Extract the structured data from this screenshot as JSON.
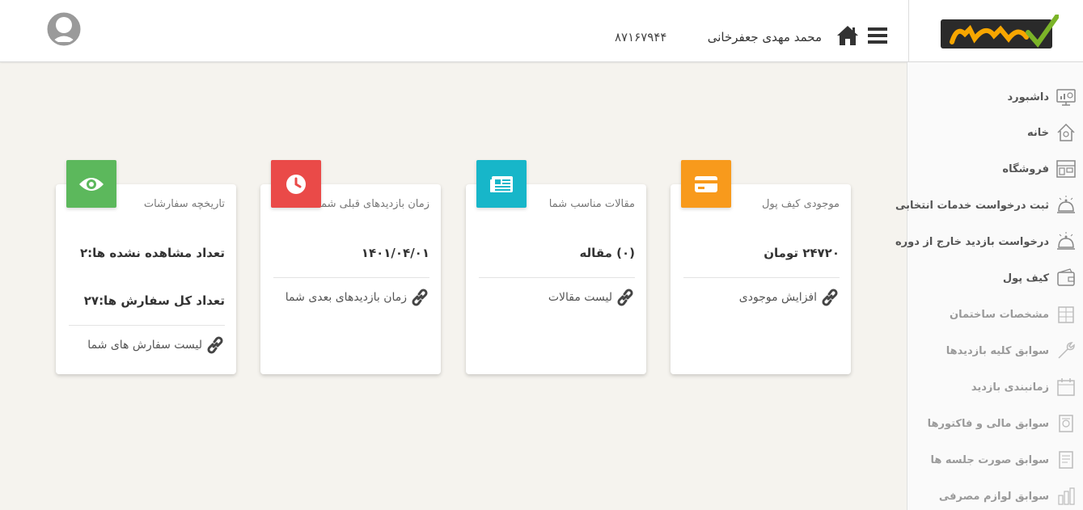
{
  "header": {
    "phone": "۸۷۱۶۷۹۴۴",
    "username": "محمد مهدی جعفرخانی",
    "home_icon": "home-icon",
    "menu_icon": "hamburger-menu-icon",
    "avatar_icon": "user-avatar-icon"
  },
  "logo": {
    "text": "ایمن تزیک",
    "colors": {
      "primary": "#f7a600",
      "dark": "#2a2a2a",
      "check": "#7bb428"
    }
  },
  "sidebar": {
    "items": [
      {
        "label": "داشبورد",
        "icon": "dashboard-icon",
        "state": "active"
      },
      {
        "label": "خانه",
        "icon": "house-icon",
        "state": "active"
      },
      {
        "label": "فروشگاه",
        "icon": "store-icon",
        "state": "active"
      },
      {
        "label": "ثبت درخواست خدمات انتخابی",
        "icon": "service-bell-icon",
        "state": "active"
      },
      {
        "label": "درخواست بازدید خارج از دوره",
        "icon": "service-bell-icon",
        "state": "active"
      },
      {
        "label": "کیف پول",
        "icon": "wallet-icon",
        "state": "active"
      },
      {
        "label": "مشخصات ساختمان",
        "icon": "building-icon",
        "state": "dim"
      },
      {
        "label": "سوابق کلیه بازدیدها",
        "icon": "wrench-icon",
        "state": "dim"
      },
      {
        "label": "زمانبندی بازدید",
        "icon": "calendar-icon",
        "state": "dim"
      },
      {
        "label": "سوابق مالی و فاکتورها",
        "icon": "invoice-icon",
        "state": "dim"
      },
      {
        "label": "سوابق صورت جلسه ها",
        "icon": "minutes-icon",
        "state": "dim"
      },
      {
        "label": "سوابق لوازم مصرفی",
        "icon": "supplies-icon",
        "state": "dim"
      }
    ]
  },
  "cards": [
    {
      "title": "موجودی کیف پول",
      "icon": "credit-card-icon",
      "color": "#f89a1c",
      "values": [
        "۲۴۷۲۰ تومان"
      ],
      "link": "افزایش موجودی"
    },
    {
      "title": "مقالات مناسب شما",
      "icon": "newspaper-icon",
      "color": "#17b6c9",
      "values": [
        "(۰) مقاله"
      ],
      "link": "لیست مقالات"
    },
    {
      "title": "زمان بازدیدهای قبلی شما",
      "icon": "clock-icon",
      "color": "#ea4a48",
      "values": [
        "۱۴۰۱/۰۴/۰۱"
      ],
      "link": "زمان بازدیدهای بعدی شما"
    },
    {
      "title": "تاریخچه سفارشات",
      "icon": "eye-icon",
      "color": "#5cb85c",
      "values": [
        "تعداد مشاهده نشده ها:۲",
        "تعداد کل سفارش ها:۲۷"
      ],
      "link": "لیست سفارش های شما"
    }
  ],
  "link_icon": "chain-link-icon"
}
